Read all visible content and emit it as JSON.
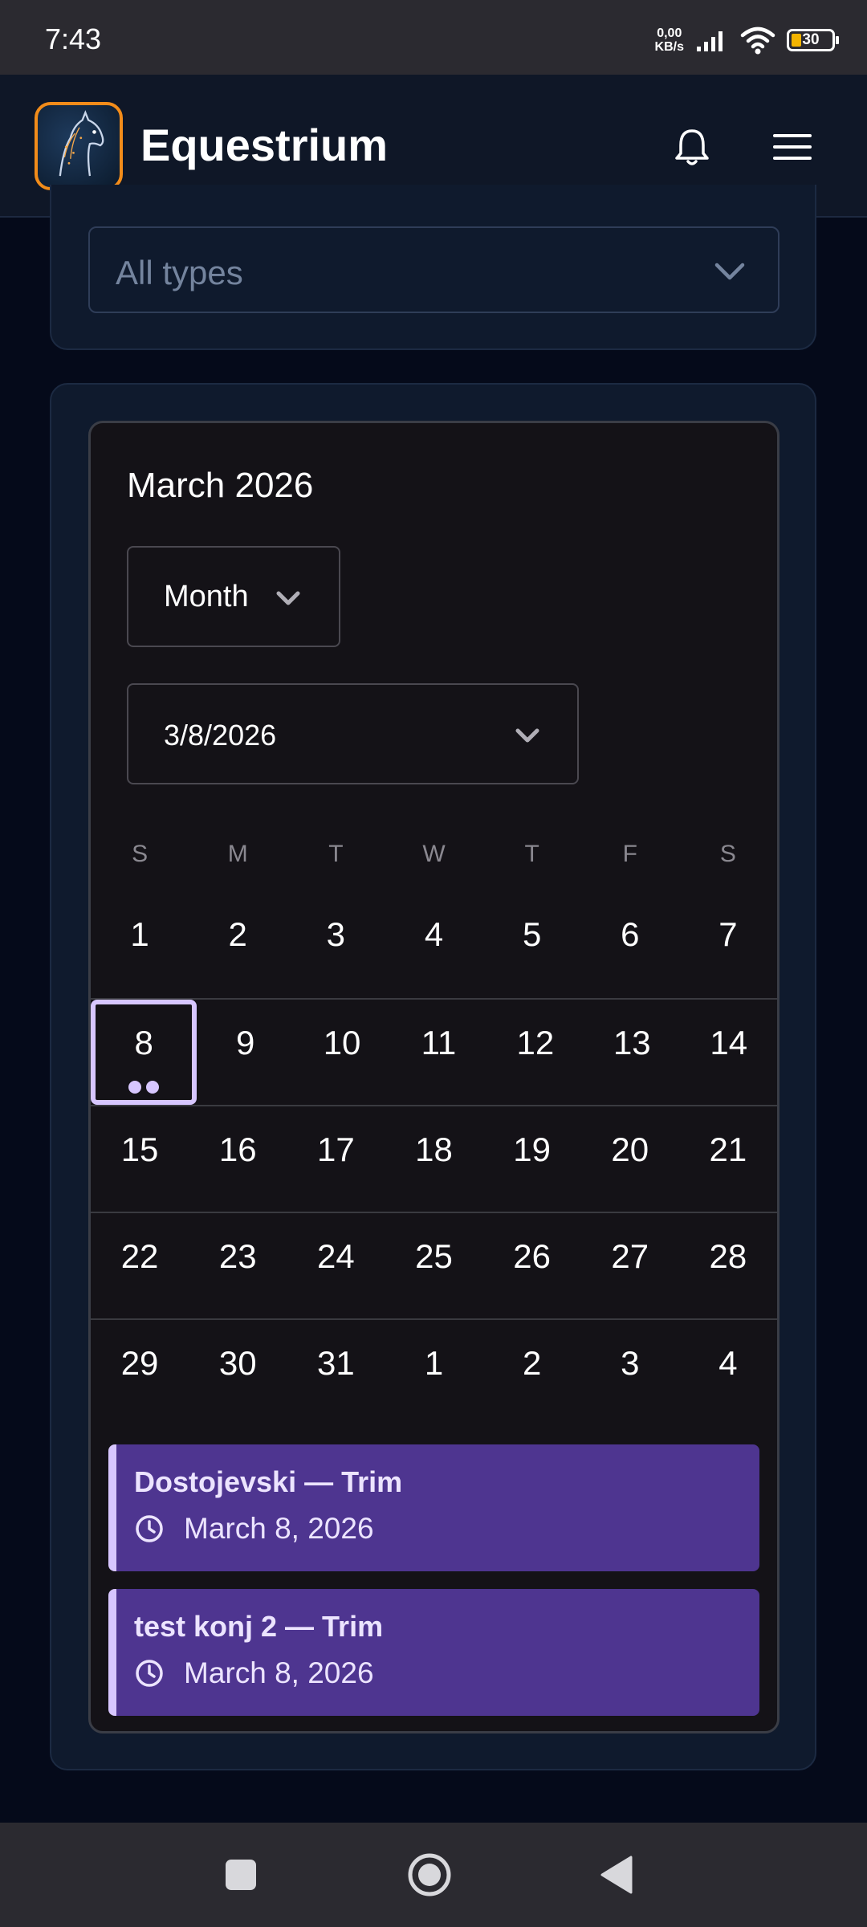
{
  "status_bar": {
    "time": "7:43",
    "net_speed_value": "0,00",
    "net_speed_unit": "KB/s",
    "battery_level": "30"
  },
  "header": {
    "app_name": "Equestrium"
  },
  "filter": {
    "type_value": "All types"
  },
  "calendar": {
    "title": "March 2026",
    "view_mode": "Month",
    "selected_date": "3/8/2026",
    "weekdays": [
      "S",
      "M",
      "T",
      "W",
      "T",
      "F",
      "S"
    ],
    "weeks": [
      [
        "1",
        "2",
        "3",
        "4",
        "5",
        "6",
        "7"
      ],
      [
        "8",
        "9",
        "10",
        "11",
        "12",
        "13",
        "14"
      ],
      [
        "15",
        "16",
        "17",
        "18",
        "19",
        "20",
        "21"
      ],
      [
        "22",
        "23",
        "24",
        "25",
        "26",
        "27",
        "28"
      ],
      [
        "29",
        "30",
        "31",
        "1",
        "2",
        "3",
        "4"
      ]
    ],
    "events": [
      {
        "name": "Dostojevski — Trim",
        "date": "March 8, 2026"
      },
      {
        "name": "test konj 2 — Trim",
        "date": "March 8, 2026"
      }
    ]
  },
  "colors": {
    "accent": "#d7c6ff",
    "event_bg": "#4e3590",
    "logo_border": "#f28c1a"
  }
}
